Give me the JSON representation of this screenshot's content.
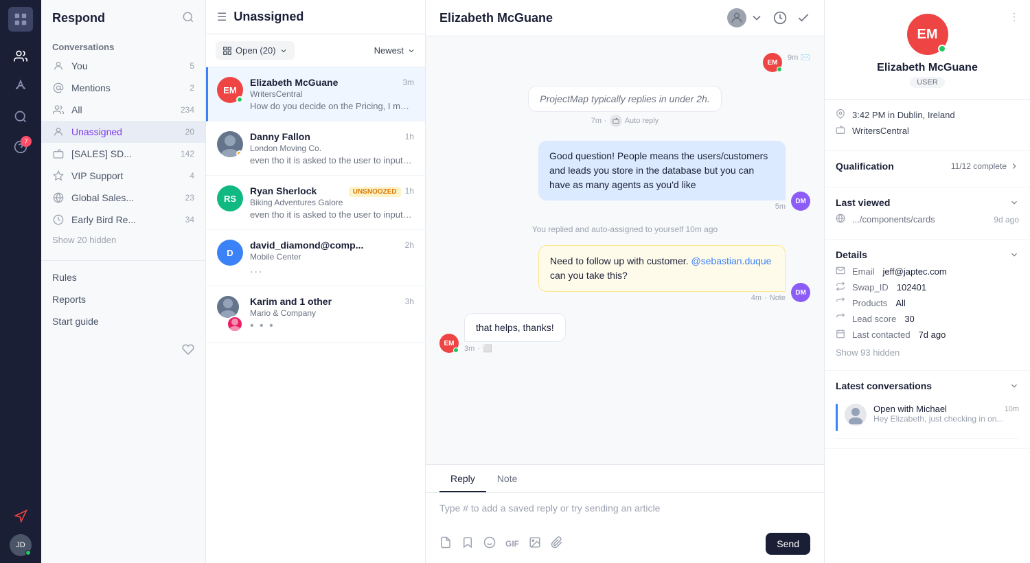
{
  "app": {
    "title": "Respond"
  },
  "iconSidebar": {
    "logo_label": "≡",
    "nav_items": [
      {
        "name": "conversations-nav-icon",
        "icon": "👥",
        "active": true
      },
      {
        "name": "rocket-nav-icon",
        "icon": "🚀"
      },
      {
        "name": "search-nav-icon",
        "icon": "🔍"
      },
      {
        "name": "question-nav-icon",
        "icon": "❓",
        "badge": "7"
      }
    ]
  },
  "leftNav": {
    "header": "Respond",
    "sections": {
      "conversations_label": "Conversations",
      "you_label": "You",
      "you_count": "5",
      "mentions_label": "Mentions",
      "mentions_count": "2",
      "all_label": "All",
      "all_count": "234",
      "unassigned_label": "Unassigned",
      "unassigned_count": "20",
      "sales_label": "[SALES] SD...",
      "sales_count": "142",
      "vip_label": "VIP Support",
      "vip_count": "4",
      "global_label": "Global Sales...",
      "global_count": "23",
      "early_label": "Early Bird Re...",
      "early_count": "34",
      "show_hidden": "Show 20 hidden"
    },
    "rules_label": "Rules",
    "reports_label": "Reports",
    "start_guide_label": "Start guide"
  },
  "convList": {
    "header": "Unassigned",
    "filter_label": "Open (20)",
    "sort_label": "Newest",
    "conversations": [
      {
        "id": "c1",
        "name": "Elizabeth McGuane",
        "company": "WritersCentral",
        "time": "3m",
        "preview": "How do you decide on the Pricing, I mean what is your definition of People? When...",
        "avatar_color": "#ef4444",
        "avatar_text": "EM",
        "online": true,
        "active": true
      },
      {
        "id": "c2",
        "name": "Danny Fallon",
        "company": "London Moving Co.",
        "time": "1h",
        "preview": "even tho it is asked to the user to input on one line, can we show more lines of text...",
        "avatar_color": "#8b5cf6",
        "avatar_type": "photo",
        "online": false
      },
      {
        "id": "c3",
        "name": "Ryan Sherlock",
        "company": "Biking Adventures Galore",
        "time": "1h",
        "preview": "even tho it is asked to the user to input on one line, can we show...",
        "avatar_color": "#10b981",
        "avatar_text": "RS",
        "online": false,
        "badge": "UNSNOOZED"
      },
      {
        "id": "c4",
        "name": "david_diamond@comp...",
        "company": "Mobile Center",
        "time": "2h",
        "preview": "...",
        "avatar_color": "#3b82f6",
        "avatar_text": "D",
        "online": false
      },
      {
        "id": "c5",
        "name": "Karim and 1 other",
        "company": "Mario & Company",
        "time": "3h",
        "preview": "...",
        "avatar_type": "photo",
        "online": false,
        "has_extra_avatar": true
      }
    ]
  },
  "chat": {
    "header_name": "Elizabeth McGuane",
    "messages": [
      {
        "type": "outgoing",
        "text": "",
        "time": "9m",
        "meta_icon": "✉️",
        "avatar_color": "#ef4444",
        "avatar_text": "EM"
      },
      {
        "type": "bot",
        "text": "ProjectMap typically replies in under 2h.",
        "time": "7m",
        "meta_suffix": "Auto reply"
      },
      {
        "type": "outgoing-right",
        "text": "Good question! People means the users/customers and leads you store in the database but you can have as many agents as you'd like",
        "time": "5m",
        "avatar_color": "#8b5cf6",
        "avatar_text": "DM"
      },
      {
        "type": "system",
        "text": "You replied and auto-assigned to yourself 10m ago"
      },
      {
        "type": "note",
        "text": "Need to follow up with customer. @sebastian.duque can you take this?",
        "time": "4m",
        "meta_suffix": "Note",
        "avatar_color": "#8b5cf6",
        "avatar_text": "DM",
        "mention": "@sebastian.duque"
      },
      {
        "type": "incoming",
        "text": "that helps, thanks!",
        "time": "3m",
        "meta_icon": "⬜",
        "avatar_color": "#ef4444",
        "avatar_text": "EM"
      }
    ],
    "reply_tab_label": "Reply",
    "note_tab_label": "Note",
    "reply_placeholder": "Type # to add a saved reply or try sending an article",
    "toolbar_items": [
      "📋",
      "🔖",
      "😊",
      "GIF",
      "🖼️",
      "📎"
    ],
    "send_button_label": "Send"
  },
  "rightPanel": {
    "name": "Elizabeth McGuane",
    "avatar_text": "EM",
    "avatar_color": "#ef4444",
    "user_badge": "USER",
    "time_location": "3:42 PM in Dublin, Ireland",
    "company": "WritersCentral",
    "qualification_label": "Qualification",
    "qualification_value": "11/12 complete",
    "last_viewed_label": "Last viewed",
    "last_viewed_url": ".../components/cards",
    "last_viewed_time": "9d ago",
    "details_label": "Details",
    "email_label": "Email",
    "email_value": "jeff@japtec.com",
    "swap_id_label": "Swap_ID",
    "swap_id_value": "102401",
    "products_label": "Products",
    "products_value": "All",
    "lead_score_label": "Lead score",
    "lead_score_value": "30",
    "last_contacted_label": "Last contacted",
    "last_contacted_value": "7d ago",
    "show_hidden_label": "Show 93 hidden",
    "latest_conv_label": "Latest conversations",
    "latest_conv_item": {
      "title": "Open with Michael",
      "time": "10m",
      "preview": "Hey Elizabeth, just checking in on..."
    }
  }
}
